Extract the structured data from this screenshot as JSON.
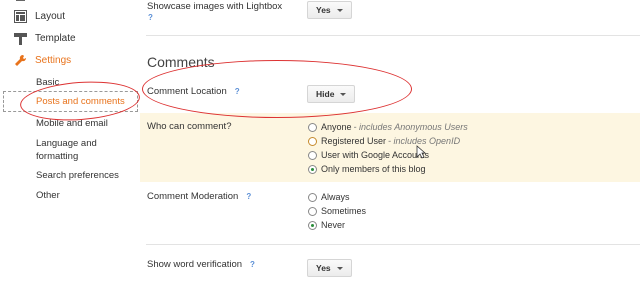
{
  "sidebar": {
    "items": [
      {
        "label": "Layout",
        "icon": "layout-icon"
      },
      {
        "label": "Template",
        "icon": "template-icon"
      },
      {
        "label": "Settings",
        "icon": "wrench-icon"
      }
    ],
    "subitems": [
      {
        "label": "Basic"
      },
      {
        "label": "Posts and comments"
      },
      {
        "label": "Mobile and email"
      },
      {
        "label": "Language and formatting"
      },
      {
        "label": "Search preferences"
      },
      {
        "label": "Other"
      }
    ],
    "active_color": "#e8731c"
  },
  "main": {
    "lightbox": {
      "label": "Showcase images with Lightbox",
      "help": "?",
      "value": "Yes"
    },
    "section_title": "Comments",
    "comment_location": {
      "label": "Comment Location",
      "help": "?",
      "value": "Hide"
    },
    "who_can_comment": {
      "label": "Who can comment?",
      "options": [
        {
          "label": "Anyone",
          "note": "- includes Anonymous Users",
          "checked": false
        },
        {
          "label": "Registered User",
          "note": "- includes OpenID",
          "checked": false
        },
        {
          "label": "User with Google Accounts",
          "note": "",
          "checked": false
        },
        {
          "label": "Only members of this blog",
          "note": "",
          "checked": true
        }
      ]
    },
    "moderation": {
      "label": "Comment Moderation",
      "help": "?",
      "options": [
        {
          "label": "Always",
          "checked": false
        },
        {
          "label": "Sometimes",
          "checked": false
        },
        {
          "label": "Never",
          "checked": true
        }
      ]
    },
    "word_verification": {
      "label": "Show word verification",
      "help": "?",
      "value": "Yes"
    }
  }
}
